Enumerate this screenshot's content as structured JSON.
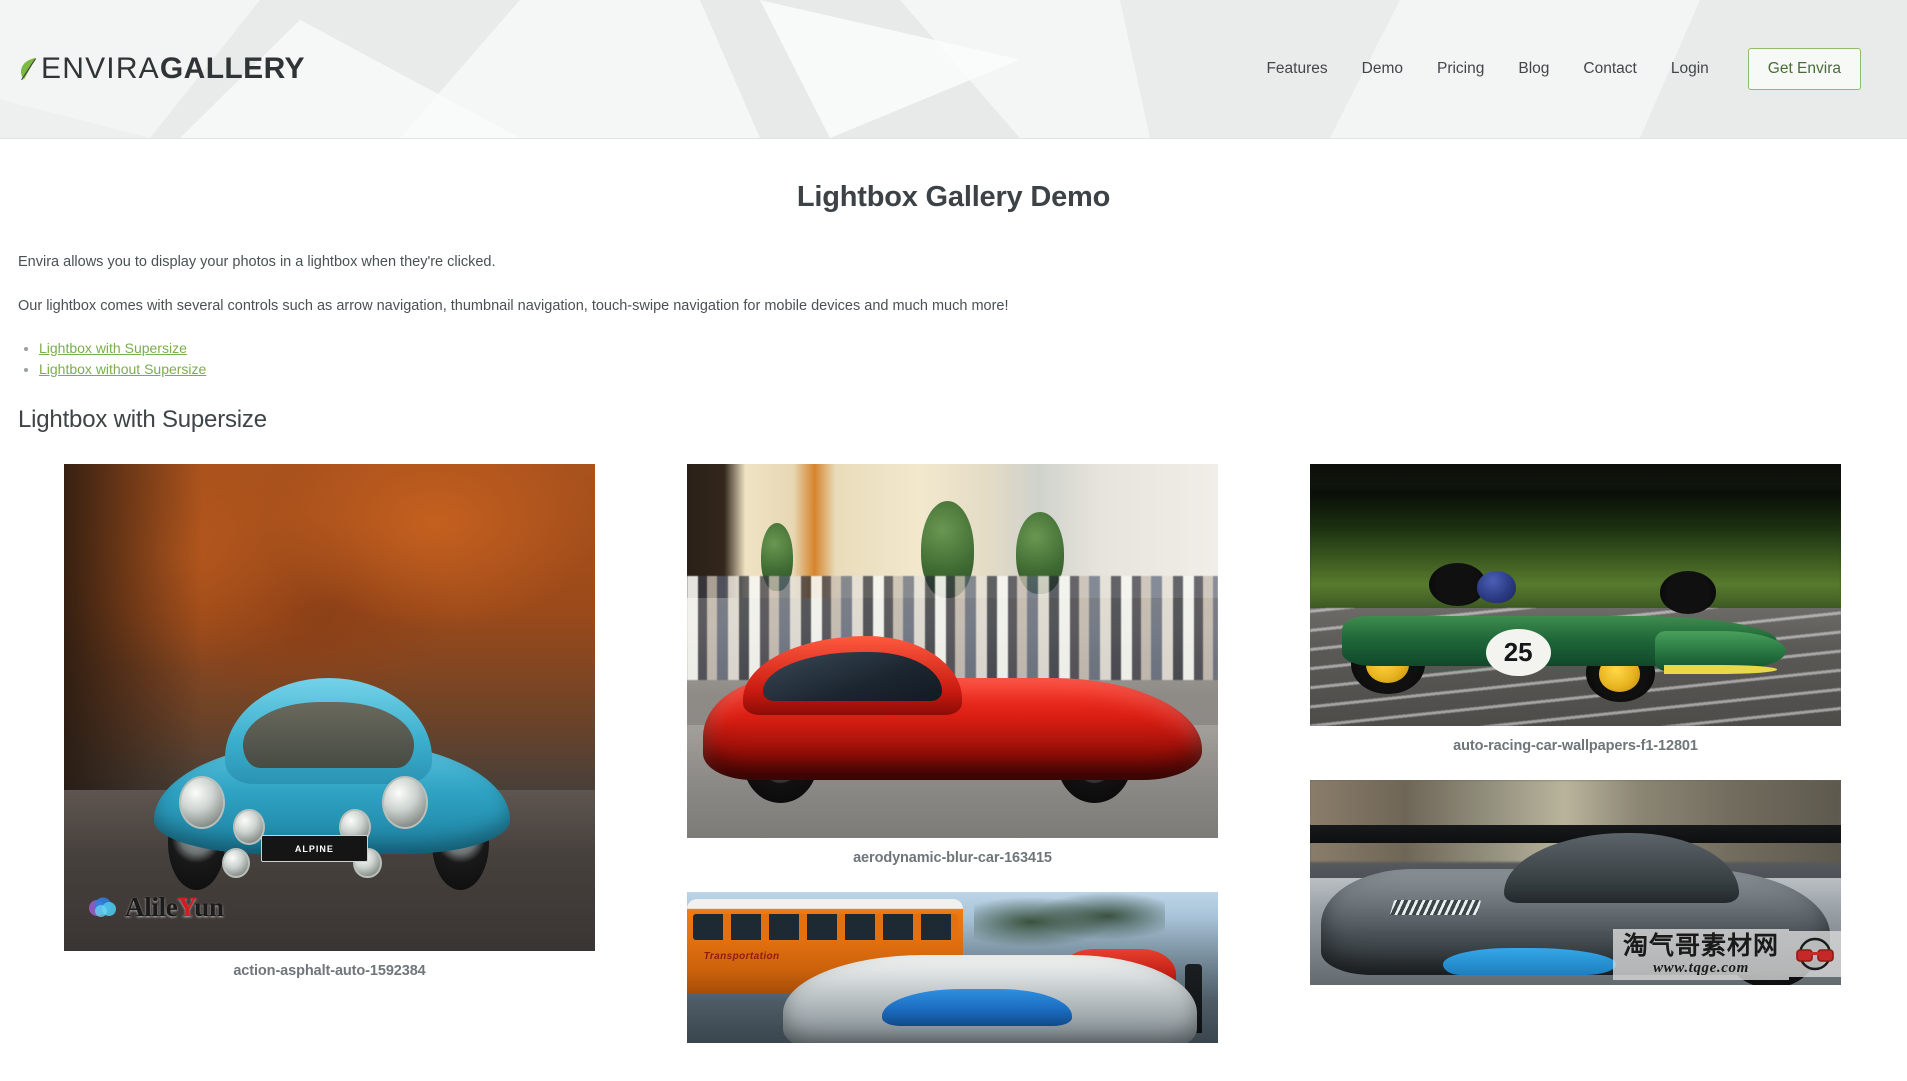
{
  "header": {
    "logo": {
      "icon": "leaf-icon",
      "text_light": "ENVIRA",
      "text_bold": "GALLERY"
    },
    "nav": [
      {
        "label": "Features"
      },
      {
        "label": "Demo"
      },
      {
        "label": "Pricing"
      },
      {
        "label": "Blog"
      },
      {
        "label": "Contact"
      },
      {
        "label": "Login"
      }
    ],
    "cta": {
      "label": "Get Envira"
    }
  },
  "main": {
    "page_title": "Lightbox Gallery Demo",
    "paragraph_1": "Envira allows you to display your photos in a lightbox when they're clicked.",
    "paragraph_2": "Our lightbox comes with several controls such as arrow navigation, thumbnail navigation, touch-swipe navigation for mobile devices and much much more!",
    "jump_links": [
      {
        "label": "Lightbox with Supersize"
      },
      {
        "label": "Lightbox without Supersize"
      }
    ],
    "section_title": "Lightbox with Supersize"
  },
  "gallery": {
    "columns": [
      {
        "items": [
          {
            "caption": "action-asphalt-auto-1592384",
            "alt": "Blue Alpine A110 classic sports car on an autumn road"
          }
        ]
      },
      {
        "items": [
          {
            "caption": "aerodynamic-blur-car-163415",
            "alt": "Red Mercedes SLS AMG parked on a city street with crowd"
          },
          {
            "caption": "",
            "alt": "Chrome silver car in front of an orange school bus"
          }
        ]
      },
      {
        "items": [
          {
            "caption": "auto-racing-car-wallpapers-f1-12801",
            "alt": "Green vintage Formula 1 car number 25 on track"
          },
          {
            "caption": "",
            "alt": "Grey Corvette with blue accents at an auto show"
          }
        ]
      }
    ],
    "f1_car_number": "25",
    "alpine_plate": "ALPINE",
    "bus_livery": "Transportation"
  },
  "watermarks": {
    "left": {
      "text_a": "Alile",
      "text_b": "Y",
      "text_c": "un",
      "icon": "cloud-icon"
    },
    "right": {
      "title": "淘气哥素材网",
      "url": "www.tqge.com",
      "icon": "glasses-icon"
    }
  },
  "colors": {
    "brand_green": "#7aad4d",
    "cta_border": "#8fbd6a",
    "cta_text": "#4b6b3b",
    "header_bg": "#eef0f0",
    "heading": "#3c4245",
    "body_text": "#4a5154",
    "caption": "#6f7679"
  }
}
